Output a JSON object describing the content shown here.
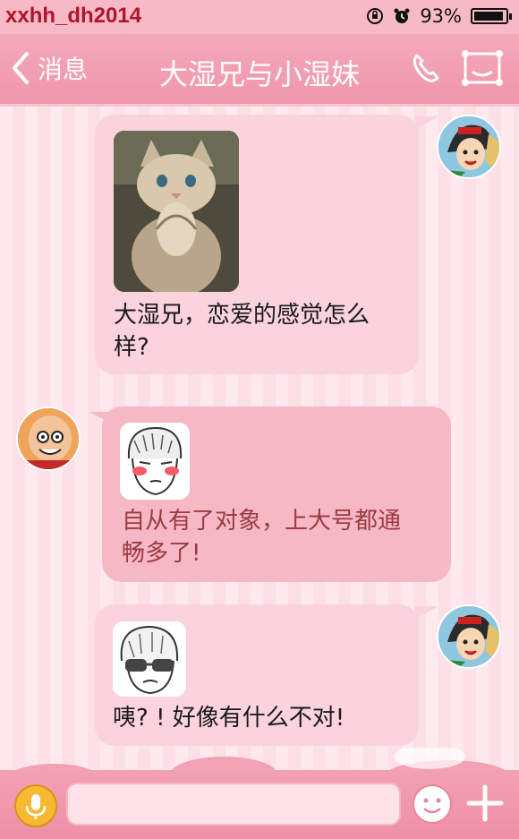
{
  "status_bar": {
    "watermark": "xxhh_dh2014",
    "battery_percent_text": "93%",
    "battery_level": 0.93,
    "icons": [
      "rotation-lock-icon",
      "alarm-icon",
      "battery-icon"
    ]
  },
  "nav": {
    "back_label": "消息",
    "title": "大湿兄与小湿妹",
    "icons": [
      "back-chevron-icon",
      "phone-icon",
      "profile-card-icon"
    ]
  },
  "messages": [
    {
      "side": "right",
      "sender": "小湿妹",
      "image": "praying-kitten-photo",
      "text": [
        "大湿兄，恋爱的感觉怎么",
        "样?"
      ],
      "text_color": "#1a1a1a"
    },
    {
      "side": "left",
      "sender": "大湿兄",
      "image": "blushing-manga-face",
      "text": [
        "自从有了对象，上大号都通",
        "畅多了!"
      ],
      "text_color": "#9b3a42"
    },
    {
      "side": "right",
      "sender": "小湿妹",
      "image": "sunglasses-manga-face",
      "text": [
        "咦? ! 好像有什么不对!"
      ],
      "text_color": "#1a1a1a"
    }
  ],
  "composer": {
    "input_value": "",
    "icons": [
      "microphone-icon",
      "emoji-icon",
      "plus-icon"
    ]
  },
  "colors": {
    "nav": "#ef96ab",
    "bubble_right": "#fbd3dc",
    "bubble_left": "#f7b8c5",
    "watermark": "#b0142a"
  }
}
